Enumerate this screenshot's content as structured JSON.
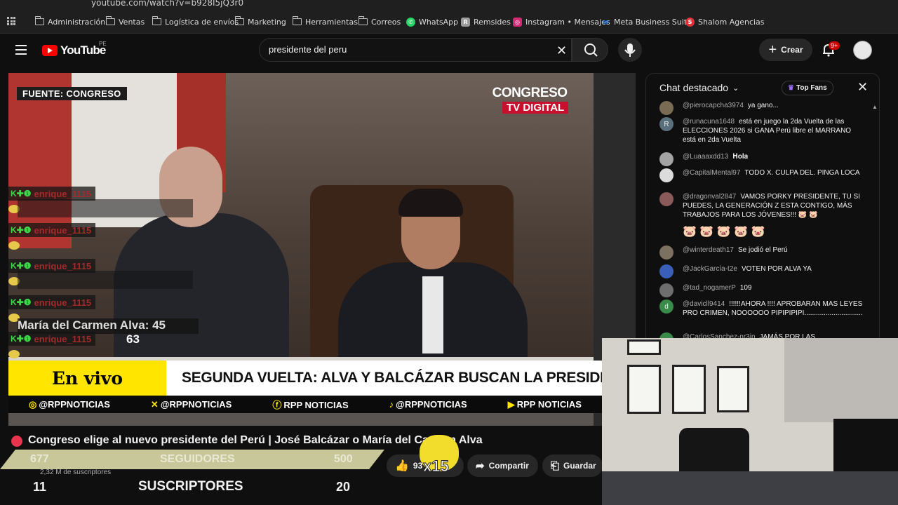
{
  "browser": {
    "url": "youtube.com/watch?v=b928I5jQ3r0",
    "bookmarks": [
      {
        "label": "Administración",
        "icon": "folder-icon"
      },
      {
        "label": "Ventas",
        "icon": "folder-icon"
      },
      {
        "label": "Logística de envíos",
        "icon": "folder-icon"
      },
      {
        "label": "Marketing",
        "icon": "folder-icon"
      },
      {
        "label": "Herramientas",
        "icon": "folder-icon"
      },
      {
        "label": "Correos",
        "icon": "folder-icon"
      },
      {
        "label": "WhatsApp",
        "icon": "whatsapp-icon",
        "color": "#25d366"
      },
      {
        "label": "Remsides",
        "icon": "remsides-icon",
        "color": "#b7b7b7"
      },
      {
        "label": "Instagram • Mensajes",
        "icon": "instagram-icon",
        "color": "#d62976"
      },
      {
        "label": "Meta Business Suite",
        "icon": "meta-icon",
        "color": "#1877f2"
      },
      {
        "label": "Shalom Agencias",
        "icon": "shalom-icon",
        "color": "#e0303a"
      }
    ]
  },
  "header": {
    "logo": "YouTube",
    "region": "PE",
    "search_query": "presidente del peru",
    "create_label": "Crear",
    "notifications": "9+"
  },
  "video": {
    "source_label": "FUENTE: CONGRESO",
    "broadcaster_line1": "CONGRESO",
    "broadcaster_line2": "TV DIGITAL",
    "live_label": "En vivo",
    "headline": "SEGUNDA VUELTA: ALVA Y BALCÁZAR BUSCAN LA PRESIDENCIA",
    "socials": [
      "@RPPNOTICIAS",
      "@RPPNOTICIAS",
      "RPP NOTICIAS",
      "@RPPNOTICIAS",
      "RPP NOTICIAS"
    ],
    "overlay_user": "enrique_1115",
    "vote_line1": "María del Carmen Alva:  45",
    "vote_line2": "63"
  },
  "below": {
    "title": "Congreso elige al nuevo presidente del Perú | José Balcázar o María del Carmen Alva",
    "seg1": "677",
    "seg2": "SEGUIDORES",
    "seg3": "500",
    "subscribers_small": "2,32 M de suscriptores",
    "sub1": "11",
    "sub2": "SUSCRIPTORES",
    "sub3": "20",
    "likes": "93",
    "share": "Compartir",
    "save": "Guardar",
    "multiplier": "x15"
  },
  "chat": {
    "title": "Chat destacado",
    "top_fans": "Top Fans",
    "messages": [
      {
        "author": "@pierocapcha3974",
        "text": "ya gano...",
        "color": "#7a6b55"
      },
      {
        "author": "@runacuna1648",
        "text": "está en juego la 2da Vuelta de las ELECCIONES 2026 si GANA Perú libre el MARRANO está en 2da Vuelta",
        "color": "#5a6f7c",
        "initial": "R"
      },
      {
        "author": "@Luaaaxdd13",
        "text": "𝐇𝐨𝐥𝐚",
        "color": "#a4a4a4"
      },
      {
        "author": "@CapitalMental97",
        "text": "TODO X. CULPA DEL. PINGA LOCA",
        "color": "#dcdcdc"
      },
      {
        "author": "@dragonval2847",
        "text": "VAMOS PORKY PRESIDENTE, TU SI PUEDES, LA GENERACIÓN Z ESTA CONTIGO, MÁS TRABAJOS PARA LOS JÓVENES!!! 🐷 🐷",
        "color": "#8a5a5a"
      },
      {
        "author": "",
        "text": "🐷 🐷 🐷 🐷 🐷",
        "color": ""
      },
      {
        "author": "@winterdeath17",
        "text": "Se jodió el Perú",
        "color": "#7c7160"
      },
      {
        "author": "@JackGarcía-t2e",
        "text": "VOTEN POR ALVA YA",
        "color": "#3a5fb8"
      },
      {
        "author": "@tad_nogamerP",
        "text": "109",
        "color": "#6e6e6e"
      },
      {
        "author": "@davicll9414",
        "text": "!!!!!!AHORA !!!! APROBARAN MAS LEYES PRO CRIMEN, NOOOOOO PIPIPIPIPI..............................",
        "color": "#3a8a4a",
        "initial": "d"
      },
      {
        "author": "@CarlosSanchez-nr3in",
        "text": "JAMÁS POR LAS",
        "color": "#3a8a4a"
      }
    ]
  }
}
